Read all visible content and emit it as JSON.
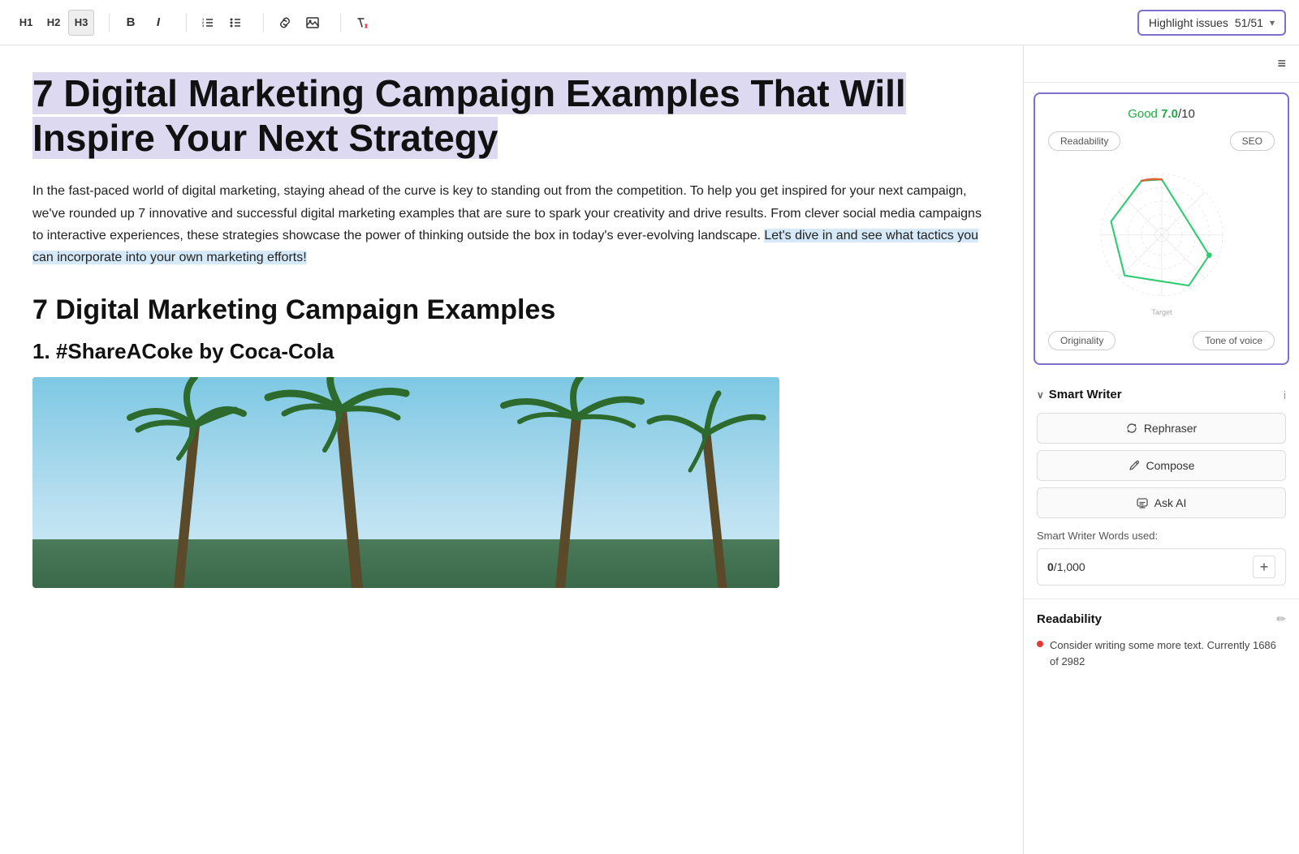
{
  "toolbar": {
    "h1_label": "H1",
    "h2_label": "H2",
    "h3_label": "H3",
    "bold_label": "B",
    "italic_label": "I",
    "ordered_list_icon": "ordered-list",
    "unordered_list_icon": "unordered-list",
    "link_icon": "link",
    "image_icon": "image",
    "clear_format_icon": "clear-format",
    "highlight_label": "Highlight issues",
    "highlight_count": "51/51",
    "highlight_chevron": "▾"
  },
  "article": {
    "title": "7 Digital Marketing Campaign Examples That Will Inspire Your Next Strategy",
    "intro": "In the fast-paced world of digital marketing, staying ahead of the curve is key to standing out from the competition. To help you get inspired for your next campaign, we've rounded up 7 innovative and successful digital marketing examples that are sure to spark your creativity and drive results. From clever social media campaigns to interactive experiences, these strategies showcase the power of thinking outside the box in today's ever-evolving landscape. Let's dive in and see what tactics you can incorporate into your own marketing efforts!",
    "h2": "7 Digital Marketing Campaign Examples",
    "h3": "1. #ShareACoke by Coca-Cola",
    "image_alt": "Palm trees against sky"
  },
  "sidebar": {
    "menu_icon": "≡",
    "score": {
      "label": "Good ",
      "value": "7.0",
      "separator": "/10",
      "tab_readability": "Readability",
      "tab_seo": "SEO",
      "target_label": "Target",
      "tab_originality": "Originality",
      "tab_tone_of_voice": "Tone of voice"
    },
    "smart_writer": {
      "title": "Smart Writer",
      "collapse_icon": "∨",
      "info_icon": "i",
      "rephraser_label": "Rephraser",
      "compose_label": "Compose",
      "ask_ai_label": "Ask AI",
      "words_label": "Smart Writer Words used:",
      "words_count": "0",
      "words_limit": "1,000",
      "add_label": "+"
    },
    "readability": {
      "title": "Readability",
      "edit_icon": "✏",
      "item": "Consider writing some more text. Currently 1686 of 2982"
    }
  }
}
